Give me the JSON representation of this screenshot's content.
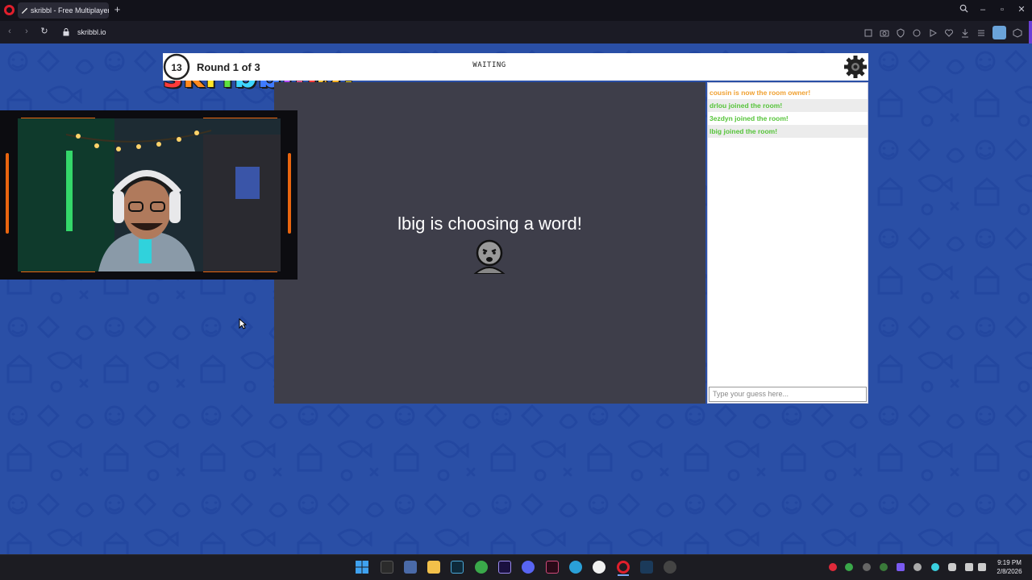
{
  "browser": {
    "tab_title": "skribbl - Free Multiplayer",
    "url": "skribbl.io",
    "new_tab": "+"
  },
  "game": {
    "logo_letters": [
      "s",
      "k",
      "r",
      "i",
      "b",
      "b",
      "l",
      ".",
      "i",
      "o",
      "!"
    ],
    "logo_colors": [
      "#ff3a3a",
      "#ff8a1e",
      "#ffe627",
      "#5ee23f",
      "#3fd6ff",
      "#3f7bff",
      "#b04bff",
      "#ff5fa2",
      "#ff3a3a",
      "#ffb11e",
      "#ffe627"
    ],
    "round_text": "Round 1 of 3",
    "timer": "13",
    "status": "WAITING",
    "overlay_text": "lbig is choosing a word!",
    "chat": [
      {
        "text": "cousin is now the room owner!",
        "color": "#f0a030"
      },
      {
        "text": "drlou joined the room!",
        "color": "#56c43a"
      },
      {
        "text": "3ezdyn joined the room!",
        "color": "#56c43a"
      },
      {
        "text": "lbig joined the room!",
        "color": "#56c43a"
      }
    ],
    "chat_placeholder": "Type your guess here..."
  },
  "taskbar": {
    "time": "9:19 PM",
    "date": "2/8/2026"
  },
  "colors": {
    "page_bg": "#2a4fa6",
    "canvas": "#3e3e4a",
    "accent_orange": "#e9650f"
  }
}
